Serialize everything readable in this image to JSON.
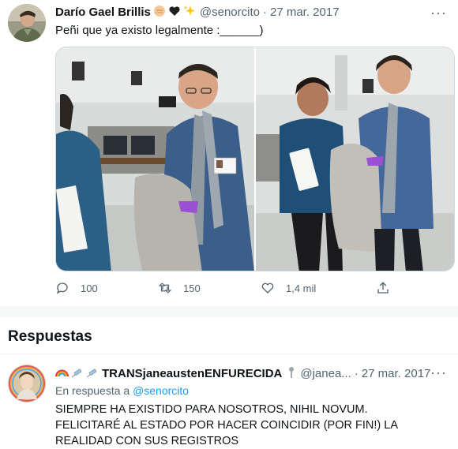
{
  "tweet": {
    "author_name": "Darío Gael Brillis",
    "author_emoji": [
      "fist-emoji",
      "black-heart-emoji",
      "sparkles-emoji"
    ],
    "handle": "@senorcito",
    "date": "27 mar. 2017",
    "text": "Peñi que ya existo legalmente :______)",
    "more_label": "···",
    "stats": {
      "replies": "100",
      "retweets": "150",
      "likes": "1,4 mil"
    }
  },
  "replies_section": {
    "title": "Respuestas"
  },
  "reply": {
    "author_prefix_emoji": [
      "rainbow-emoji",
      "syringe-emoji",
      "syringe-emoji"
    ],
    "author_name": "TRANSjaneaustenENFURECIDA",
    "author_suffix_emoji": "pin-emoji",
    "handle": "@janea...",
    "date": "27 mar. 2017",
    "replying_prefix": "En respuesta a",
    "replying_handle": "@senorcito",
    "text": "SIEMPRE HA EXISTIDO PARA NOSOTROS, NIHIL NOVUM. FELICITARÉ AL ESTADO POR HACER COINCIDIR (POR FIN!) LA REALIDAD CON SUS REGISTROS",
    "more_label": "···"
  },
  "colors": {
    "text": "#0f1419",
    "muted": "#536471",
    "link": "#1d9bf0",
    "divider": "#f7f9f9"
  }
}
